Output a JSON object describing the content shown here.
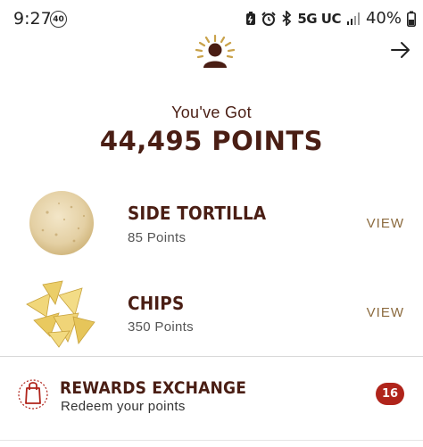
{
  "status_bar": {
    "time": "9:27",
    "notification_count": "40",
    "network": "5G UC",
    "battery": "40%"
  },
  "header": {
    "logo_icon": "sun-person-logo-icon",
    "next_icon": "arrow-right-icon"
  },
  "points": {
    "label": "You've Got",
    "value": "44,495 POINTS"
  },
  "rewards": [
    {
      "name": "SIDE TORTILLA",
      "points": "85 Points",
      "action": "VIEW",
      "icon": "tortilla-image"
    },
    {
      "name": "CHIPS",
      "points": "350 Points",
      "action": "VIEW",
      "icon": "chips-image"
    }
  ],
  "exchange": {
    "title": "REWARDS EXCHANGE",
    "subtitle": "Redeem your points",
    "badge": "16",
    "icon": "shopping-bag-icon"
  },
  "colors": {
    "brand_brown": "#4a1e14",
    "gold": "#8c6b3f",
    "badge_red": "#b0241b"
  }
}
